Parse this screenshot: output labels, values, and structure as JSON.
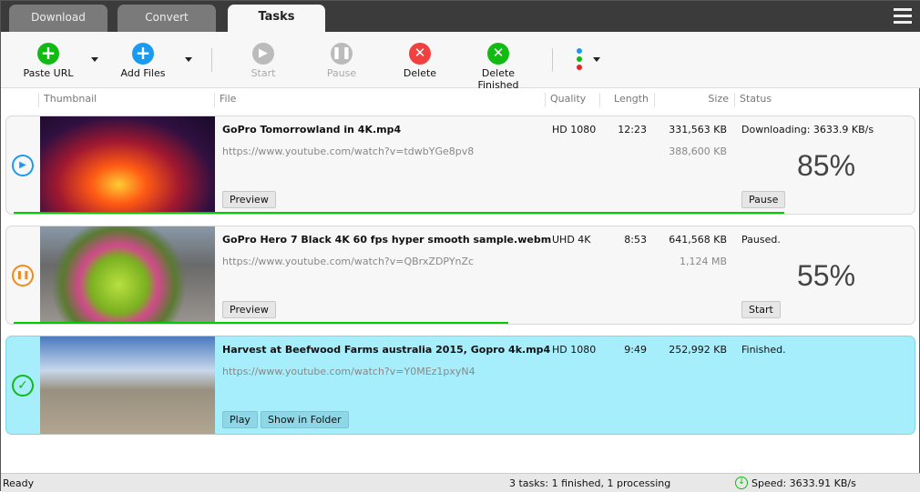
{
  "tabs": [
    {
      "label": "Download"
    },
    {
      "label": "Convert"
    },
    {
      "label": "Tasks",
      "active": true
    }
  ],
  "toolbar": {
    "paste_url": "Paste URL",
    "add_files": "Add Files",
    "start": "Start",
    "pause": "Pause",
    "delete": "Delete",
    "delete_finished": "Delete Finished"
  },
  "columns": {
    "thumbnail": "Thumbnail",
    "file": "File",
    "quality": "Quality",
    "length": "Length",
    "size": "Size",
    "status": "Status"
  },
  "tasks": [
    {
      "file": "GoPro  Tomorrowland in 4K.mp4",
      "url": "https://www.youtube.com/watch?v=tdwbYGe8pv8",
      "quality": "HD 1080",
      "length": "12:23",
      "size": "331,563 KB",
      "total": "388,600 KB",
      "status": "Downloading: 3633.9 KB/s",
      "percent": "85%",
      "progress": 85,
      "state": "downloading",
      "buttons": [
        "Preview",
        "Pause"
      ]
    },
    {
      "file": "GoPro Hero 7 Black 4K 60 fps hyper smooth sample.webm",
      "url": "https://www.youtube.com/watch?v=QBrxZDPYnZc",
      "quality": "UHD 4K",
      "length": "8:53",
      "size": "641,568 KB",
      "total": "1,124 MB",
      "status": "Paused.",
      "percent": "55%",
      "progress": 55,
      "state": "paused",
      "buttons": [
        "Preview",
        "Start"
      ]
    },
    {
      "file": "Harvest at Beefwood Farms australia 2015, Gopro 4k.mp4",
      "url": "https://www.youtube.com/watch?v=Y0MEz1pxyN4",
      "quality": "HD 1080",
      "length": "9:49",
      "size": "252,992 KB",
      "status": "Finished.",
      "state": "finished",
      "buttons": [
        "Play",
        "Show in Folder"
      ]
    }
  ],
  "statusbar": {
    "left": "Ready",
    "tasks": "3 tasks: 1 finished, 1 processing",
    "speed": "Speed: 3633.91 KB/s"
  },
  "colors": {
    "green": "#11bb11",
    "blue": "#1a9af0",
    "red": "#f04040",
    "progress": "#00cc00",
    "finished_row": "#a6eefc"
  }
}
